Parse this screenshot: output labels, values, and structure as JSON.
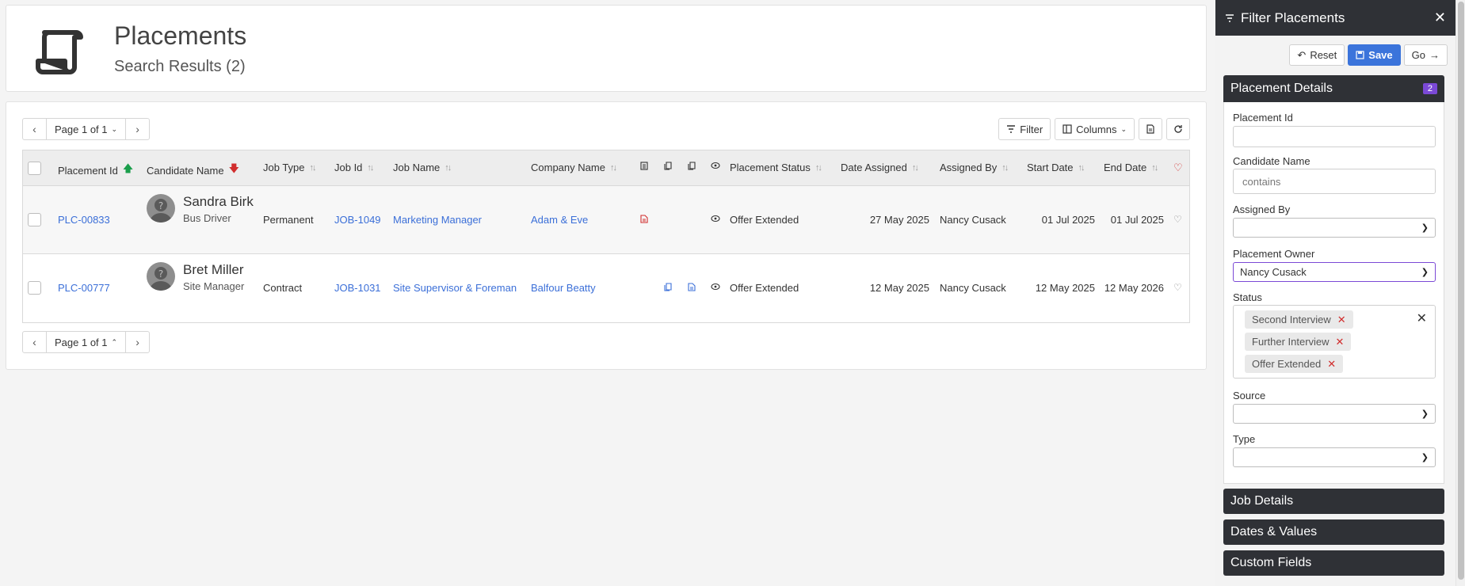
{
  "header": {
    "icon": "scroll-icon",
    "title": "Placements",
    "subtitle": "Search Results (2)"
  },
  "pager": {
    "label": "Page 1 of 1",
    "prev": "‹",
    "next": "›"
  },
  "toolbar": {
    "filter_label": "Filter",
    "columns_label": "Columns"
  },
  "table": {
    "columns": [
      "Placement Id",
      "Candidate Name",
      "Job Type",
      "Job Id",
      "Job Name",
      "Company Name",
      "Placement Status",
      "Date Assigned",
      "Assigned By",
      "Start Date",
      "End Date"
    ],
    "rows": [
      {
        "placement_id": "PLC-00833",
        "candidate_name": "Sandra Birk",
        "candidate_role": "Bus Driver",
        "job_type": "Permanent",
        "job_id": "JOB-1049",
        "job_name": "Marketing Manager",
        "company_name": "Adam & Eve",
        "placement_status": "Offer Extended",
        "date_assigned": "27 May 2025",
        "assigned_by": "Nancy Cusack",
        "start_date": "01 Jul 2025",
        "end_date": "01 Jul 2025"
      },
      {
        "placement_id": "PLC-00777",
        "candidate_name": "Bret Miller",
        "candidate_role": "Site Manager",
        "job_type": "Contract",
        "job_id": "JOB-1031",
        "job_name": "Site Supervisor & Foreman",
        "company_name": "Balfour Beatty",
        "placement_status": "Offer Extended",
        "date_assigned": "12 May 2025",
        "assigned_by": "Nancy Cusack",
        "start_date": "12 May 2025",
        "end_date": "12 May 2026"
      }
    ]
  },
  "filter_panel": {
    "title": "Filter Placements",
    "reset_label": "Reset",
    "save_label": "Save",
    "go_label": "Go",
    "placement_details": {
      "title": "Placement Details",
      "count": "2",
      "placement_id_label": "Placement Id",
      "placement_id_value": "",
      "candidate_name_label": "Candidate Name",
      "candidate_name_placeholder": "contains",
      "assigned_by_label": "Assigned By",
      "assigned_by_value": "",
      "placement_owner_label": "Placement Owner",
      "placement_owner_value": "Nancy Cusack",
      "status_label": "Status",
      "status_chips": [
        "Second Interview",
        "Further Interview",
        "Offer Extended"
      ],
      "source_label": "Source",
      "source_value": "",
      "type_label": "Type",
      "type_value": ""
    },
    "job_details_title": "Job Details",
    "dates_values_title": "Dates & Values",
    "custom_fields_title": "Custom Fields"
  },
  "colors": {
    "link": "#3b6fd8",
    "dark_header": "#2f3136",
    "accent_purple": "#7b49d6",
    "save_blue": "#3b74db",
    "sort_up_green": "#1a9e4b",
    "sort_down_red": "#d12d2d",
    "icon_red": "#d12d2d"
  }
}
